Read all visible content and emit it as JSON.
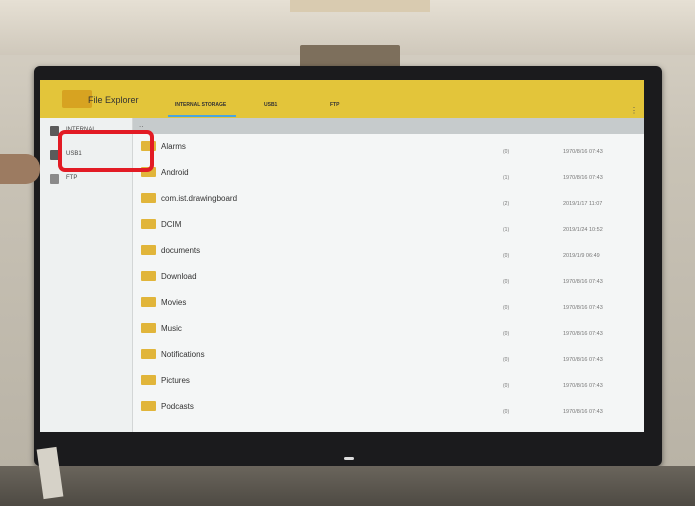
{
  "app": {
    "title": "File Explorer",
    "tabs": [
      "INTERNAL STORAGE",
      "USB1",
      "FTP"
    ],
    "active_tab": "INTERNAL STORAGE"
  },
  "sidebar": {
    "items": [
      {
        "label": "INTERNAL",
        "icon": "internal-storage-icon"
      },
      {
        "label": "USB1",
        "icon": "usb-icon"
      },
      {
        "label": "FTP",
        "icon": "ftp-icon"
      }
    ],
    "highlighted": "USB1"
  },
  "path": "..",
  "files": [
    {
      "name": "Alarms",
      "count": "(0)",
      "date": "1970/8/16 07:43"
    },
    {
      "name": "Android",
      "count": "(1)",
      "date": "1970/8/16 07:43"
    },
    {
      "name": "com.ist.drawingboard",
      "count": "(2)",
      "date": "2019/1/17 11:07"
    },
    {
      "name": "DCIM",
      "count": "(1)",
      "date": "2019/1/24 10:52"
    },
    {
      "name": "documents",
      "count": "(0)",
      "date": "2019/1/9 06:49"
    },
    {
      "name": "Download",
      "count": "(0)",
      "date": "1970/8/16 07:43"
    },
    {
      "name": "Movies",
      "count": "(0)",
      "date": "1970/8/16 07:43"
    },
    {
      "name": "Music",
      "count": "(0)",
      "date": "1970/8/16 07:43"
    },
    {
      "name": "Notifications",
      "count": "(0)",
      "date": "1970/8/16 07:43"
    },
    {
      "name": "Pictures",
      "count": "(0)",
      "date": "1970/8/16 07:43"
    },
    {
      "name": "Podcasts",
      "count": "(0)",
      "date": "1970/8/16 07:43"
    }
  ],
  "colors": {
    "appbar": "#e3c53a",
    "highlight": "#e21b24",
    "folder": "#e1b53a",
    "tab_underline": "#4aa5e0"
  }
}
